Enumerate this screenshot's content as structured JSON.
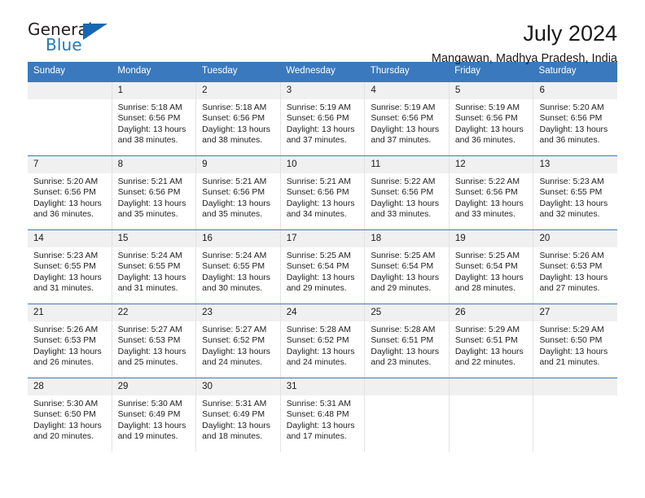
{
  "brand": {
    "word1": "General",
    "word2": "Blue",
    "logo_icon": "triangle-logo"
  },
  "header": {
    "title": "July 2024",
    "location": "Mangawan, Madhya Pradesh, India"
  },
  "colors": {
    "header_blue": "#3a79bd",
    "brand_blue": "#1f7ac0",
    "daynum_bg": "#f0f0f0",
    "cell_border": "#e2e2e2",
    "text": "#1a1a1a"
  },
  "calendar": {
    "day_headers": [
      "Sunday",
      "Monday",
      "Tuesday",
      "Wednesday",
      "Thursday",
      "Friday",
      "Saturday"
    ],
    "weeks": [
      [
        {
          "day": "",
          "sunrise": "",
          "sunset": "",
          "daylight1": "",
          "daylight2": ""
        },
        {
          "day": "1",
          "sunrise": "Sunrise: 5:18 AM",
          "sunset": "Sunset: 6:56 PM",
          "daylight1": "Daylight: 13 hours",
          "daylight2": "and 38 minutes."
        },
        {
          "day": "2",
          "sunrise": "Sunrise: 5:18 AM",
          "sunset": "Sunset: 6:56 PM",
          "daylight1": "Daylight: 13 hours",
          "daylight2": "and 38 minutes."
        },
        {
          "day": "3",
          "sunrise": "Sunrise: 5:19 AM",
          "sunset": "Sunset: 6:56 PM",
          "daylight1": "Daylight: 13 hours",
          "daylight2": "and 37 minutes."
        },
        {
          "day": "4",
          "sunrise": "Sunrise: 5:19 AM",
          "sunset": "Sunset: 6:56 PM",
          "daylight1": "Daylight: 13 hours",
          "daylight2": "and 37 minutes."
        },
        {
          "day": "5",
          "sunrise": "Sunrise: 5:19 AM",
          "sunset": "Sunset: 6:56 PM",
          "daylight1": "Daylight: 13 hours",
          "daylight2": "and 36 minutes."
        },
        {
          "day": "6",
          "sunrise": "Sunrise: 5:20 AM",
          "sunset": "Sunset: 6:56 PM",
          "daylight1": "Daylight: 13 hours",
          "daylight2": "and 36 minutes."
        }
      ],
      [
        {
          "day": "7",
          "sunrise": "Sunrise: 5:20 AM",
          "sunset": "Sunset: 6:56 PM",
          "daylight1": "Daylight: 13 hours",
          "daylight2": "and 36 minutes."
        },
        {
          "day": "8",
          "sunrise": "Sunrise: 5:21 AM",
          "sunset": "Sunset: 6:56 PM",
          "daylight1": "Daylight: 13 hours",
          "daylight2": "and 35 minutes."
        },
        {
          "day": "9",
          "sunrise": "Sunrise: 5:21 AM",
          "sunset": "Sunset: 6:56 PM",
          "daylight1": "Daylight: 13 hours",
          "daylight2": "and 35 minutes."
        },
        {
          "day": "10",
          "sunrise": "Sunrise: 5:21 AM",
          "sunset": "Sunset: 6:56 PM",
          "daylight1": "Daylight: 13 hours",
          "daylight2": "and 34 minutes."
        },
        {
          "day": "11",
          "sunrise": "Sunrise: 5:22 AM",
          "sunset": "Sunset: 6:56 PM",
          "daylight1": "Daylight: 13 hours",
          "daylight2": "and 33 minutes."
        },
        {
          "day": "12",
          "sunrise": "Sunrise: 5:22 AM",
          "sunset": "Sunset: 6:56 PM",
          "daylight1": "Daylight: 13 hours",
          "daylight2": "and 33 minutes."
        },
        {
          "day": "13",
          "sunrise": "Sunrise: 5:23 AM",
          "sunset": "Sunset: 6:55 PM",
          "daylight1": "Daylight: 13 hours",
          "daylight2": "and 32 minutes."
        }
      ],
      [
        {
          "day": "14",
          "sunrise": "Sunrise: 5:23 AM",
          "sunset": "Sunset: 6:55 PM",
          "daylight1": "Daylight: 13 hours",
          "daylight2": "and 31 minutes."
        },
        {
          "day": "15",
          "sunrise": "Sunrise: 5:24 AM",
          "sunset": "Sunset: 6:55 PM",
          "daylight1": "Daylight: 13 hours",
          "daylight2": "and 31 minutes."
        },
        {
          "day": "16",
          "sunrise": "Sunrise: 5:24 AM",
          "sunset": "Sunset: 6:55 PM",
          "daylight1": "Daylight: 13 hours",
          "daylight2": "and 30 minutes."
        },
        {
          "day": "17",
          "sunrise": "Sunrise: 5:25 AM",
          "sunset": "Sunset: 6:54 PM",
          "daylight1": "Daylight: 13 hours",
          "daylight2": "and 29 minutes."
        },
        {
          "day": "18",
          "sunrise": "Sunrise: 5:25 AM",
          "sunset": "Sunset: 6:54 PM",
          "daylight1": "Daylight: 13 hours",
          "daylight2": "and 29 minutes."
        },
        {
          "day": "19",
          "sunrise": "Sunrise: 5:25 AM",
          "sunset": "Sunset: 6:54 PM",
          "daylight1": "Daylight: 13 hours",
          "daylight2": "and 28 minutes."
        },
        {
          "day": "20",
          "sunrise": "Sunrise: 5:26 AM",
          "sunset": "Sunset: 6:53 PM",
          "daylight1": "Daylight: 13 hours",
          "daylight2": "and 27 minutes."
        }
      ],
      [
        {
          "day": "21",
          "sunrise": "Sunrise: 5:26 AM",
          "sunset": "Sunset: 6:53 PM",
          "daylight1": "Daylight: 13 hours",
          "daylight2": "and 26 minutes."
        },
        {
          "day": "22",
          "sunrise": "Sunrise: 5:27 AM",
          "sunset": "Sunset: 6:53 PM",
          "daylight1": "Daylight: 13 hours",
          "daylight2": "and 25 minutes."
        },
        {
          "day": "23",
          "sunrise": "Sunrise: 5:27 AM",
          "sunset": "Sunset: 6:52 PM",
          "daylight1": "Daylight: 13 hours",
          "daylight2": "and 24 minutes."
        },
        {
          "day": "24",
          "sunrise": "Sunrise: 5:28 AM",
          "sunset": "Sunset: 6:52 PM",
          "daylight1": "Daylight: 13 hours",
          "daylight2": "and 24 minutes."
        },
        {
          "day": "25",
          "sunrise": "Sunrise: 5:28 AM",
          "sunset": "Sunset: 6:51 PM",
          "daylight1": "Daylight: 13 hours",
          "daylight2": "and 23 minutes."
        },
        {
          "day": "26",
          "sunrise": "Sunrise: 5:29 AM",
          "sunset": "Sunset: 6:51 PM",
          "daylight1": "Daylight: 13 hours",
          "daylight2": "and 22 minutes."
        },
        {
          "day": "27",
          "sunrise": "Sunrise: 5:29 AM",
          "sunset": "Sunset: 6:50 PM",
          "daylight1": "Daylight: 13 hours",
          "daylight2": "and 21 minutes."
        }
      ],
      [
        {
          "day": "28",
          "sunrise": "Sunrise: 5:30 AM",
          "sunset": "Sunset: 6:50 PM",
          "daylight1": "Daylight: 13 hours",
          "daylight2": "and 20 minutes."
        },
        {
          "day": "29",
          "sunrise": "Sunrise: 5:30 AM",
          "sunset": "Sunset: 6:49 PM",
          "daylight1": "Daylight: 13 hours",
          "daylight2": "and 19 minutes."
        },
        {
          "day": "30",
          "sunrise": "Sunrise: 5:31 AM",
          "sunset": "Sunset: 6:49 PM",
          "daylight1": "Daylight: 13 hours",
          "daylight2": "and 18 minutes."
        },
        {
          "day": "31",
          "sunrise": "Sunrise: 5:31 AM",
          "sunset": "Sunset: 6:48 PM",
          "daylight1": "Daylight: 13 hours",
          "daylight2": "and 17 minutes."
        },
        {
          "day": "",
          "sunrise": "",
          "sunset": "",
          "daylight1": "",
          "daylight2": ""
        },
        {
          "day": "",
          "sunrise": "",
          "sunset": "",
          "daylight1": "",
          "daylight2": ""
        },
        {
          "day": "",
          "sunrise": "",
          "sunset": "",
          "daylight1": "",
          "daylight2": ""
        }
      ]
    ]
  }
}
